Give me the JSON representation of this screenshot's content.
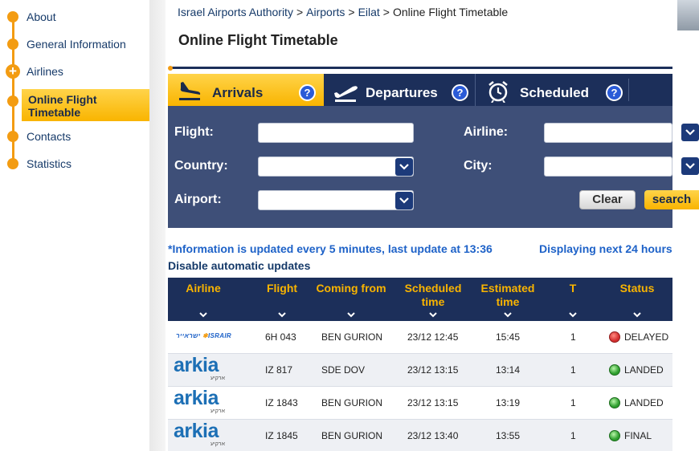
{
  "sidebar": {
    "items": [
      {
        "label": "About"
      },
      {
        "label": "General Information"
      },
      {
        "label": "Airlines"
      },
      {
        "label": "Online Flight Timetable"
      },
      {
        "label": "Contacts"
      },
      {
        "label": "Statistics"
      }
    ]
  },
  "breadcrumb": {
    "items": [
      "Israel Airports Authority",
      "Airports",
      "Eilat"
    ],
    "current": "Online Flight Timetable",
    "separator": ">"
  },
  "page": {
    "title": "Online Flight Timetable"
  },
  "tabs": [
    {
      "label": "Arrivals",
      "help": "?"
    },
    {
      "label": "Departures",
      "help": "?"
    },
    {
      "label": "Scheduled",
      "help": "?"
    }
  ],
  "search": {
    "flight_label": "Flight:",
    "flight_value": "",
    "airline_label": "Airline:",
    "airline_value": "",
    "country_label": "Country:",
    "country_value": "",
    "city_label": "City:",
    "city_value": "",
    "airport_label": "Airport:",
    "airport_value": "",
    "clear_label": "Clear",
    "search_label": "search"
  },
  "info": {
    "update_text": "*Information is updated every 5 minutes, last update at 13:36",
    "display_text": "Displaying next 24 hours",
    "disable_link": "Disable automatic updates"
  },
  "table": {
    "columns": [
      "Airline",
      "Flight",
      "Coming from",
      "Scheduled time",
      "Estimated time",
      "T",
      "Status"
    ],
    "rows": [
      {
        "airline_logo": "israir",
        "logo_text": "ISRAIR",
        "flight": "6H 043",
        "from": "BEN GURION",
        "scheduled": "23/12 12:45",
        "estimated": "15:45",
        "terminal": "1",
        "status_color": "red",
        "status": "DELAYED"
      },
      {
        "airline_logo": "arkia",
        "logo_text": "arkia",
        "flight": "IZ 817",
        "from": "SDE DOV",
        "scheduled": "23/12 13:15",
        "estimated": "13:14",
        "terminal": "1",
        "status_color": "green",
        "status": "LANDED"
      },
      {
        "airline_logo": "arkia",
        "logo_text": "arkia",
        "flight": "IZ 1843",
        "from": "BEN GURION",
        "scheduled": "23/12 13:15",
        "estimated": "13:19",
        "terminal": "1",
        "status_color": "green",
        "status": "LANDED"
      },
      {
        "airline_logo": "arkia",
        "logo_text": "arkia",
        "flight": "IZ 1845",
        "from": "BEN GURION",
        "scheduled": "23/12 13:40",
        "estimated": "13:55",
        "terminal": "1",
        "status_color": "green",
        "status": "FINAL"
      }
    ]
  },
  "colors": {
    "navy": "#1c2f5a",
    "panel": "#3e4f78",
    "accent_yellow": "#f9b400",
    "accent_orange": "#f39c12",
    "link_blue": "#1e62c8"
  }
}
